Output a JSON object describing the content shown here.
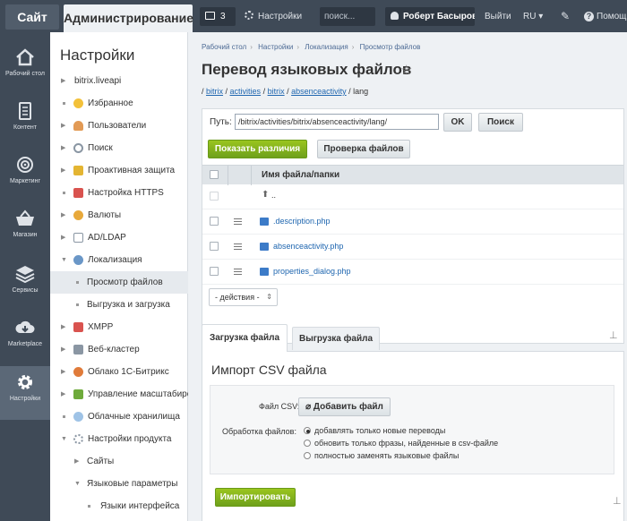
{
  "topbar": {
    "site": "Сайт",
    "admin": "Администрирование",
    "notifications": "3",
    "settings": "Настройки",
    "search_placeholder": "поиск...",
    "user": "Роберт Басыров",
    "exit": "Выйти",
    "lang": "RU",
    "help": "Помощь"
  },
  "leftbar": [
    {
      "label": "Рабочий стол",
      "icon": "home-icon"
    },
    {
      "label": "Контент",
      "icon": "document-icon"
    },
    {
      "label": "Маркетинг",
      "icon": "target-icon"
    },
    {
      "label": "Магазин",
      "icon": "basket-icon"
    },
    {
      "label": "Сервисы",
      "icon": "layers-icon"
    },
    {
      "label": "Marketplace",
      "icon": "cloud-download-icon"
    },
    {
      "label": "Настройки",
      "icon": "gear-icon"
    }
  ],
  "menu": {
    "title": "Настройки",
    "items": [
      {
        "label": "bitrix.liveapi"
      },
      {
        "label": "Избранное"
      },
      {
        "label": "Пользователи"
      },
      {
        "label": "Поиск"
      },
      {
        "label": "Проактивная защита"
      },
      {
        "label": "Настройка HTTPS"
      },
      {
        "label": "Валюты"
      },
      {
        "label": "AD/LDAP"
      },
      {
        "label": "Локализация"
      },
      {
        "label": "Просмотр файлов"
      },
      {
        "label": "Выгрузка и загрузка"
      },
      {
        "label": "XMPP"
      },
      {
        "label": "Веб-кластер"
      },
      {
        "label": "Облако 1С-Битрикс"
      },
      {
        "label": "Управление масштабированием"
      },
      {
        "label": "Облачные хранилища"
      },
      {
        "label": "Настройки продукта"
      },
      {
        "label": "Сайты"
      },
      {
        "label": "Языковые параметры"
      },
      {
        "label": "Языки интерфейса"
      }
    ]
  },
  "breadcrumb": [
    "Рабочий стол",
    "Настройки",
    "Локализация",
    "Просмотр файлов"
  ],
  "page_title": "Перевод языковых файлов",
  "path_links": [
    "bitrix",
    "activities",
    "bitrix",
    "absenceactivity"
  ],
  "path_tail": "lang",
  "path": {
    "label": "Путь:",
    "value": "/bitrix/activities/bitrix/absenceactivity/lang/",
    "ok": "OK",
    "search": "Поиск"
  },
  "buttons": {
    "diff": "Показать различия",
    "check": "Проверка файлов"
  },
  "grid": {
    "header": "Имя файла/папки",
    "up": "..",
    "files": [
      ".description.php",
      "absenceactivity.php",
      "properties_dialog.php"
    ],
    "actions": "- действия -"
  },
  "tabs": {
    "upload": "Загрузка файла",
    "download": "Выгрузка файла"
  },
  "import": {
    "title": "Импорт CSV файла",
    "csv_label": "Файл CSV:",
    "add_file": "Добавить файл",
    "proc_label": "Обработка файлов:",
    "options": [
      "добавлять только новые переводы",
      "обновить только фразы, найденные в csv-файле",
      "полностью заменять языковые файлы"
    ],
    "import_button": "Импортировать"
  }
}
